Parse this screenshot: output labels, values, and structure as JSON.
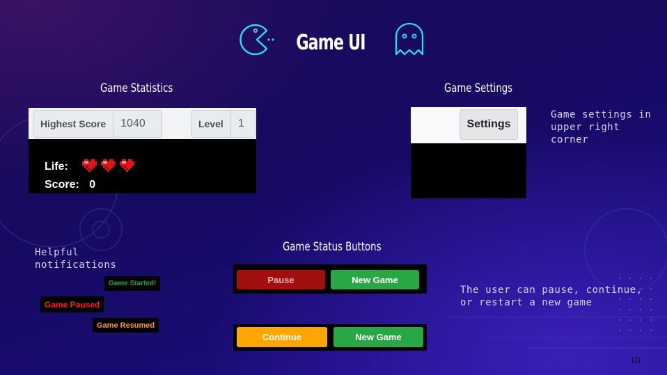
{
  "title": "Game UI",
  "sections": {
    "statistics": "Game Statistics",
    "settings": "Game Settings",
    "status_buttons": "Game Status Buttons"
  },
  "stats": {
    "highest_score_label": "Highest Score",
    "highest_score_value": "1040",
    "level_label": "Level",
    "level_value": "1",
    "life_label": "Life:",
    "lives": 3,
    "score_label": "Score:",
    "score_value": "0"
  },
  "settings": {
    "button_label": "Settings",
    "note": "Game settings in upper right corner"
  },
  "notifications": {
    "note": "Helpful notifications",
    "started": "Game Started!",
    "paused": "Game Paused",
    "resumed": "Game Resumed"
  },
  "status_buttons": {
    "pause": "Pause",
    "new_game_1": "New Game",
    "continue": "Continue",
    "new_game_2": "New Game",
    "note": "The user can pause, continue, or restart a new game"
  },
  "page_number": "10",
  "colors": {
    "pause": "#a10f0f",
    "new_game": "#28a745",
    "continue": "#ffa500",
    "started_text": "#1fa83a",
    "paused_text": "#ff1a1a",
    "resumed_text": "#ff9a1f",
    "icon_cyan": "#2ad8f0"
  },
  "icons": [
    "pacman-icon",
    "ghost-icon",
    "heart-icon"
  ]
}
